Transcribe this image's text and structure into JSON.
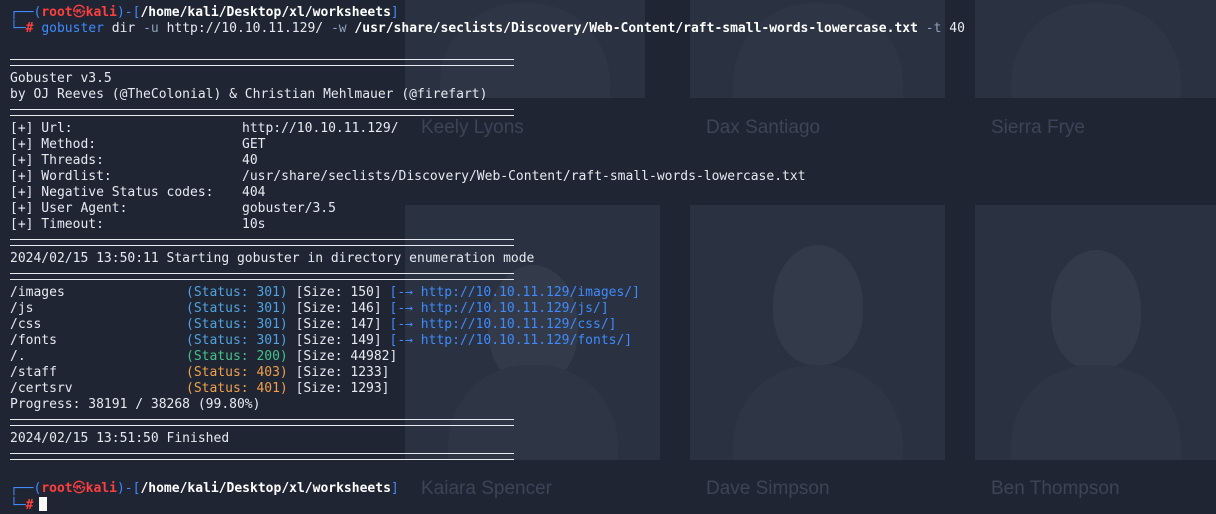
{
  "prompt": {
    "user": "root",
    "skull": "㉿",
    "host": "kali",
    "cwd": "/home/kali/Desktop/xl/worksheets",
    "symbol": "#"
  },
  "command": {
    "bin": "gobuster",
    "sub": "dir",
    "flag_u": "-u",
    "url": "http://10.10.11.129/",
    "flag_w": "-w",
    "wordlist": "/usr/share/seclists/Discovery/Web-Content/raft-small-words-lowercase.txt",
    "flag_t": "-t",
    "threads": "40"
  },
  "banner": {
    "title": "Gobuster v3.5",
    "authors": "by OJ Reeves (@TheColonial) & Christian Mehlmauer (@firefart)"
  },
  "config": [
    {
      "label": "[+] Url:",
      "value": "http://10.10.11.129/"
    },
    {
      "label": "[+] Method:",
      "value": "GET"
    },
    {
      "label": "[+] Threads:",
      "value": "40"
    },
    {
      "label": "[+] Wordlist:",
      "value": "/usr/share/seclists/Discovery/Web-Content/raft-small-words-lowercase.txt"
    },
    {
      "label": "[+] Negative Status codes:",
      "value": "404"
    },
    {
      "label": "[+] User Agent:",
      "value": "gobuster/3.5"
    },
    {
      "label": "[+] Timeout:",
      "value": "10s"
    }
  ],
  "start_line": "2024/02/15 13:50:11 Starting gobuster in directory enumeration mode",
  "results": [
    {
      "path": "/images",
      "status": "(Status: 301)",
      "size": "[Size: 150]",
      "redirect": "[-→ http://10.10.11.129/images/]"
    },
    {
      "path": "/js",
      "status": "(Status: 301)",
      "size": "[Size: 146]",
      "redirect": "[-→ http://10.10.11.129/js/]"
    },
    {
      "path": "/css",
      "status": "(Status: 301)",
      "size": "[Size: 147]",
      "redirect": "[-→ http://10.10.11.129/css/]"
    },
    {
      "path": "/fonts",
      "status": "(Status: 301)",
      "size": "[Size: 149]",
      "redirect": "[-→ http://10.10.11.129/fonts/]"
    },
    {
      "path": "/.",
      "status": "(Status: 200)",
      "size": "[Size: 44982]",
      "redirect": ""
    },
    {
      "path": "/staff",
      "status": "(Status: 403)",
      "size": "[Size: 1233]",
      "redirect": ""
    },
    {
      "path": "/certsrv",
      "status": "(Status: 401)",
      "size": "[Size: 1293]",
      "redirect": ""
    }
  ],
  "progress": "Progress: 38191 / 38268 (99.80%)",
  "finished_line": "2024/02/15 13:51:50 Finished",
  "background_names": [
    "Keely Lyons",
    "Dax Santiago",
    "Sierra Frye",
    "Kaiara Spencer",
    "Dave Simpson",
    "Ben Thompson"
  ],
  "colors": {
    "prompt_blue": "#3f8bfd",
    "prompt_red": "#ff3f3f",
    "status_301": "#4fa3e0",
    "status_200": "#45c28a",
    "status_40x": "#f0a04b",
    "background": "#1f2533"
  }
}
